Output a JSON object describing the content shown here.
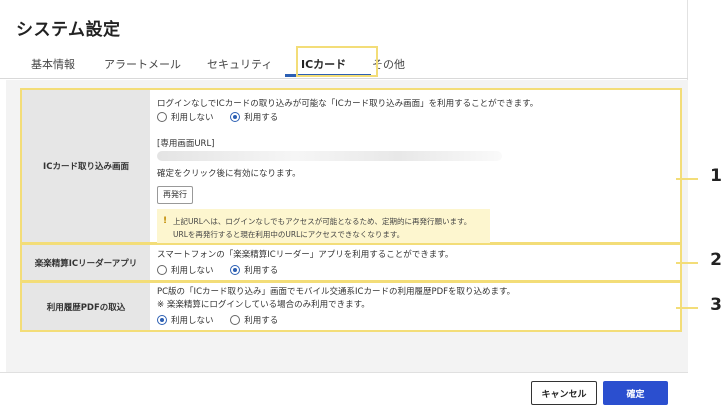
{
  "page": {
    "title": "システム設定"
  },
  "tabs": [
    {
      "label": "基本情報"
    },
    {
      "label": "アラートメール"
    },
    {
      "label": "セキュリティ"
    },
    {
      "label": "ICカード"
    },
    {
      "label": "その他"
    }
  ],
  "active_tab": "ICカード",
  "sections": {
    "ic": {
      "label": "ICカード取り込み画面",
      "desc": "ログインなしでICカードの取り込みが可能な「ICカード取り込み画面」を利用することができます。",
      "radio_off": "利用しない",
      "radio_on": "利用する",
      "selected": "利用する",
      "url_label": "[専用画面URL]",
      "confirm_note": "確定をクリック後に有効になります。",
      "reissue": "再発行",
      "warn_mark": "!",
      "warn_line1": "上記URLへは、ログインなしでもアクセスが可能となるため、定期的に再発行願います。",
      "warn_line2": "URLを再発行すると現在利用中のURLにアクセスできなくなります。"
    },
    "reader": {
      "label": "楽楽精算ICリーダーアプリ",
      "desc": "スマートフォンの「楽楽精算ICリーダー」アプリを利用することができます。",
      "radio_off": "利用しない",
      "radio_on": "利用する",
      "selected": "利用する"
    },
    "pdf": {
      "label": "利用履歴PDFの取込",
      "desc": "PC版の「ICカード取り込み」画面でモバイル交通系ICカードの利用履歴PDFを取り込めます。",
      "note": "※ 楽楽精算にログインしている場合のみ利用できます。",
      "radio_off": "利用しない",
      "radio_on": "利用する",
      "selected": "利用しない"
    }
  },
  "callouts": [
    "1",
    "2",
    "3"
  ],
  "footer": {
    "cancel": "キャンセル",
    "ok": "確定"
  },
  "colors": {
    "accent": "#2b4fcf",
    "highlight": "#f3dd78",
    "warning_bg": "#fdf6cf"
  }
}
